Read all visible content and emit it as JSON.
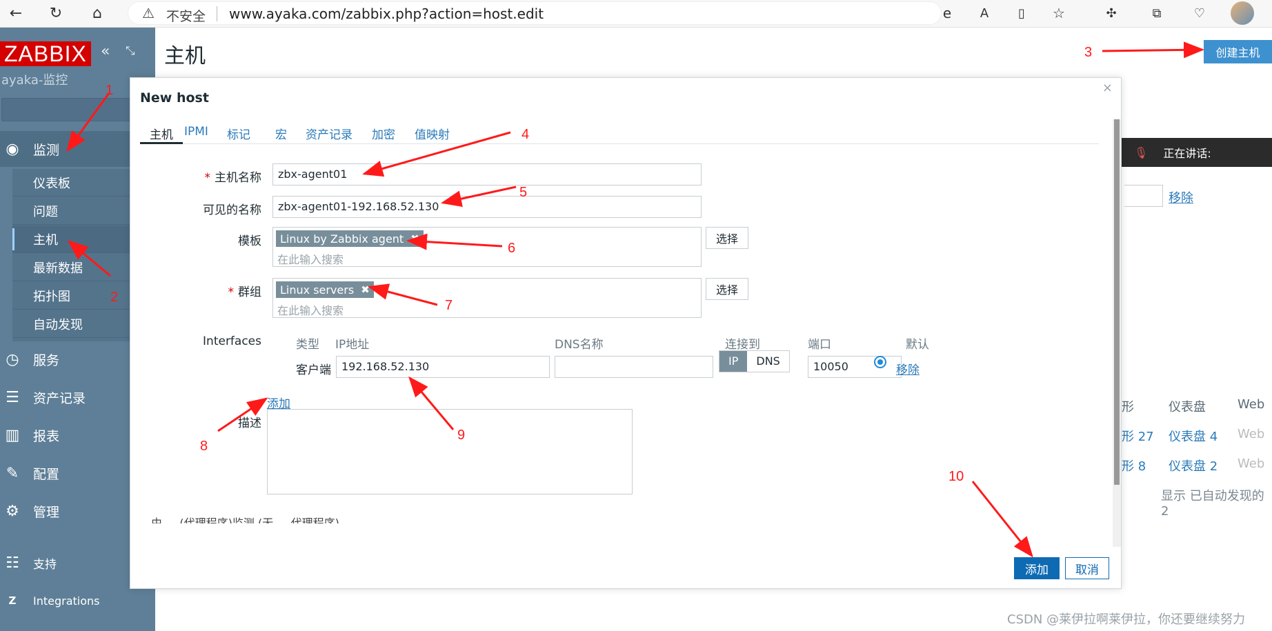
{
  "browser": {
    "insecure_label": "不安全",
    "url": "www.ayaka.com/zabbix.php?action=host.edit"
  },
  "sidebar": {
    "logo": "ZABBIX",
    "site_name": "ayaka-监控",
    "menu": [
      {
        "label": "监测",
        "icon": "eye-icon"
      },
      {
        "label": "服务",
        "icon": "clock-icon"
      },
      {
        "label": "资产记录",
        "icon": "list-icon"
      },
      {
        "label": "报表",
        "icon": "bar-chart-icon"
      },
      {
        "label": "配置",
        "icon": "wrench-icon"
      },
      {
        "label": "管理",
        "icon": "gear-icon"
      },
      {
        "label": "支持",
        "icon": "support-icon"
      },
      {
        "label": "Integrations",
        "icon": "z-icon"
      }
    ],
    "submenu": [
      "仪表板",
      "问题",
      "主机",
      "最新数据",
      "拓扑图",
      "自动发现"
    ]
  },
  "page": {
    "title": "主机",
    "create_button": "创建主机"
  },
  "background": {
    "speaking_label": "正在讲话:",
    "remove_link": "移除",
    "headers": [
      "形",
      "仪表盘",
      "Web"
    ],
    "rows": [
      [
        "形 27",
        "仪表盘 4",
        "Web"
      ],
      [
        "形 8",
        "仪表盘 2",
        "Web"
      ]
    ],
    "footer": "显示 已自动发现的 2"
  },
  "modal": {
    "title": "New host",
    "close": "×",
    "tabs": [
      "主机",
      "IPMI",
      "标记",
      "宏",
      "资产记录",
      "加密",
      "值映射"
    ],
    "fields": {
      "host_name_label": "主机名称",
      "host_name_value": "zbx-agent01",
      "visible_name_label": "可见的名称",
      "visible_name_value": "zbx-agent01-192.168.52.130",
      "templates_label": "模板",
      "template_chip": "Linux by Zabbix agent",
      "groups_label": "群组",
      "group_chip": "Linux servers",
      "search_placeholder": "在此输入搜索",
      "select_button": "选择",
      "interfaces_label": "Interfaces",
      "description_label": "描述",
      "cut_row": "由 ... (代理程序)监测    (无 ... 代理程序)"
    },
    "interfaces": {
      "headers": [
        "类型",
        "IP地址",
        "DNS名称",
        "连接到",
        "端口",
        "默认"
      ],
      "type": "客户端",
      "ip": "192.168.52.130",
      "dns": "",
      "connect_ip": "IP",
      "connect_dns": "DNS",
      "port": "10050",
      "remove_link": "移除",
      "add_link": "添加"
    },
    "buttons": {
      "add": "添加",
      "cancel": "取消"
    }
  },
  "annotations": [
    "1",
    "2",
    "3",
    "4",
    "5",
    "6",
    "7",
    "8",
    "9",
    "10"
  ],
  "watermark": "CSDN @莱伊拉啊莱伊拉，你还要继续努力",
  "colors": {
    "sidebar": "#5e7f97",
    "logo_red": "#d40000",
    "primary": "#0e6ab3",
    "link": "#2a7ab9",
    "annotation": "#ff1a1a"
  }
}
